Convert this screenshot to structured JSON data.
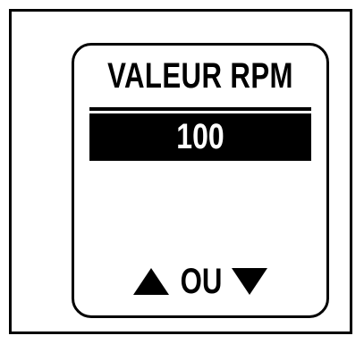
{
  "display": {
    "title": "VALEUR RPM",
    "value": "100",
    "or_label": "OU",
    "up_icon": "triangle-up-icon",
    "down_icon": "triangle-down-icon"
  },
  "colors": {
    "foreground": "#000000",
    "background": "#ffffff"
  }
}
